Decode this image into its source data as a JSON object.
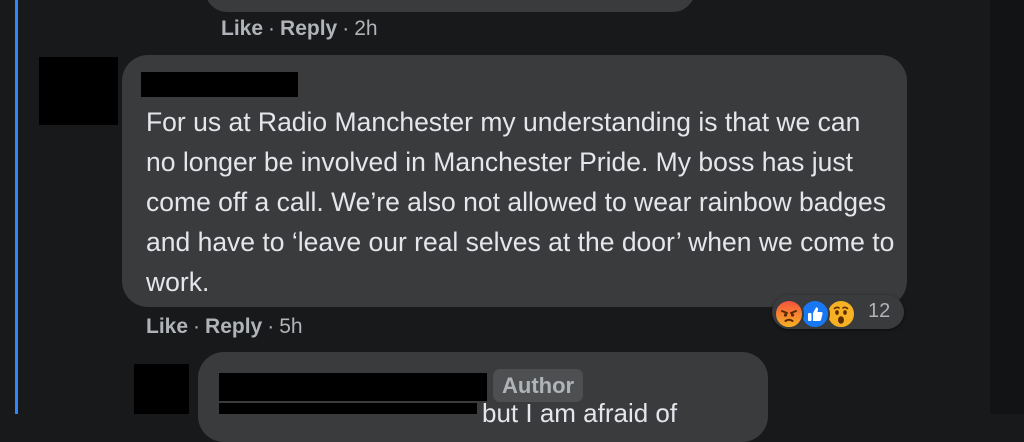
{
  "previous_comment": {
    "actions": {
      "like_label": "Like",
      "reply_label": "Reply",
      "separator": "·",
      "time": "2h"
    }
  },
  "main_comment": {
    "text": "For us at Radio Manchester my understanding is that we can no longer be involved in Manchester Pride. My boss has just come off a call. We’re also not allowed to wear rainbow badges and have to ‘leave our real selves at the door’ when we come to work.",
    "reactions": {
      "icons": [
        "angry-reaction-icon",
        "like-reaction-icon",
        "wow-reaction-icon"
      ],
      "count": "12"
    },
    "actions": {
      "like_label": "Like",
      "reply_label": "Reply",
      "separator": "·",
      "time": "5h"
    }
  },
  "reply": {
    "author_badge": "Author",
    "partial_text": "but I am afraid of"
  },
  "colors": {
    "background": "#18191a",
    "bubble": "#3a3b3c",
    "text": "#e4e6eb",
    "secondary_text": "#b0b3b8",
    "thread_line": "#2d88ff"
  }
}
